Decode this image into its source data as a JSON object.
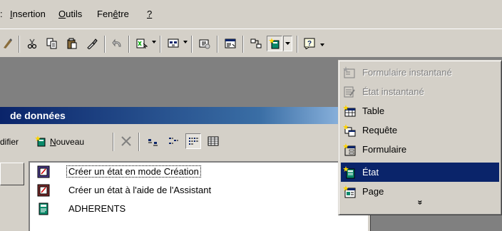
{
  "menubar": {
    "items": [
      {
        "label": "Insertion",
        "mnemonic_index": 0
      },
      {
        "label": "Outils",
        "mnemonic_index": 0
      },
      {
        "label": "Fenêtre",
        "mnemonic_index": 3
      },
      {
        "label": "?",
        "mnemonic_index": 0
      }
    ]
  },
  "toolbar": {
    "icons": [
      "spelling-icon",
      "cut-icon",
      "copy-icon",
      "paste-icon",
      "format-painter-icon",
      "undo-icon",
      "office-links-icon",
      "analyze-icon",
      "code-icon",
      "properties-icon",
      "relationships-icon",
      "new-object-report-icon",
      "help-icon"
    ]
  },
  "db_window": {
    "title": "de données",
    "toolbar": {
      "modify_label": "difier",
      "new_label": "Nouveau",
      "new_mnemonic": "N",
      "new_rest": "ouveau"
    },
    "list": [
      {
        "label": "Créer un état en mode Création",
        "icon": "report-design-icon",
        "selected": true
      },
      {
        "label": "Créer un état à l'aide de l'Assistant",
        "icon": "report-wizard-icon",
        "selected": false
      },
      {
        "label": "ADHERENTS",
        "icon": "report-icon",
        "selected": false
      }
    ]
  },
  "new_object_menu": {
    "items": [
      {
        "label": "Formulaire instantané",
        "icon": "autoform-icon",
        "enabled": false,
        "active": false
      },
      {
        "label": "État instantané",
        "icon": "autoreport-icon",
        "enabled": false,
        "active": false
      },
      {
        "label": "Table",
        "icon": "table-icon",
        "enabled": true,
        "active": false
      },
      {
        "label": "Requête",
        "icon": "query-icon",
        "enabled": true,
        "active": false
      },
      {
        "label": "Formulaire",
        "icon": "form-icon",
        "enabled": true,
        "active": false
      },
      {
        "label": "État",
        "icon": "report-icon",
        "enabled": true,
        "active": true
      },
      {
        "label": "Page",
        "icon": "page-icon",
        "enabled": true,
        "active": false
      }
    ],
    "more_label": "»"
  },
  "colors": {
    "face": "#d4d0c8",
    "highlight": "#0a246a",
    "titlebar_start": "#0a246a",
    "titlebar_end": "#a6caf0",
    "app_background": "#808080"
  }
}
